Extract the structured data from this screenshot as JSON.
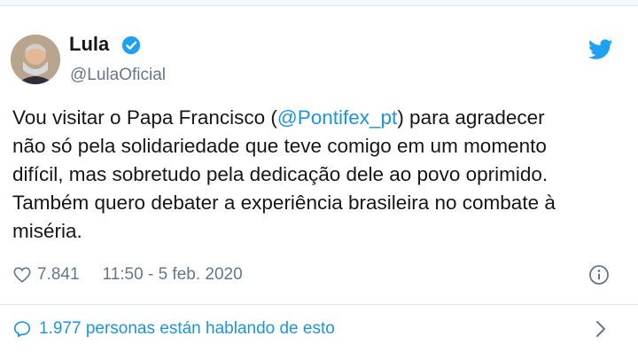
{
  "tweet": {
    "display_name": "Lula",
    "handle": "@LulaOficial",
    "text_before_mention": "Vou visitar o Papa Francisco (",
    "mention": "@Pontifex_pt",
    "text_after_mention": ") para agradecer\nnão só pela solidariedade que teve comigo em um momento\ndifícil, mas sobretudo pela dedicação dele ao povo oprimido.\nTambém quero debater a experiência brasileira no combate à\nmiséria.",
    "likes": "7.841",
    "timestamp": "11:50 - 5 feb. 2020"
  },
  "conversation": {
    "label": "1.977 personas están hablando de esto"
  },
  "colors": {
    "accent": "#1b95e0",
    "secondary_text": "#657786",
    "divider": "#e1e8ed"
  },
  "icons": [
    "verified-badge-icon",
    "twitter-bird-icon",
    "heart-icon",
    "info-icon",
    "speech-bubble-icon",
    "chevron-right-icon"
  ]
}
